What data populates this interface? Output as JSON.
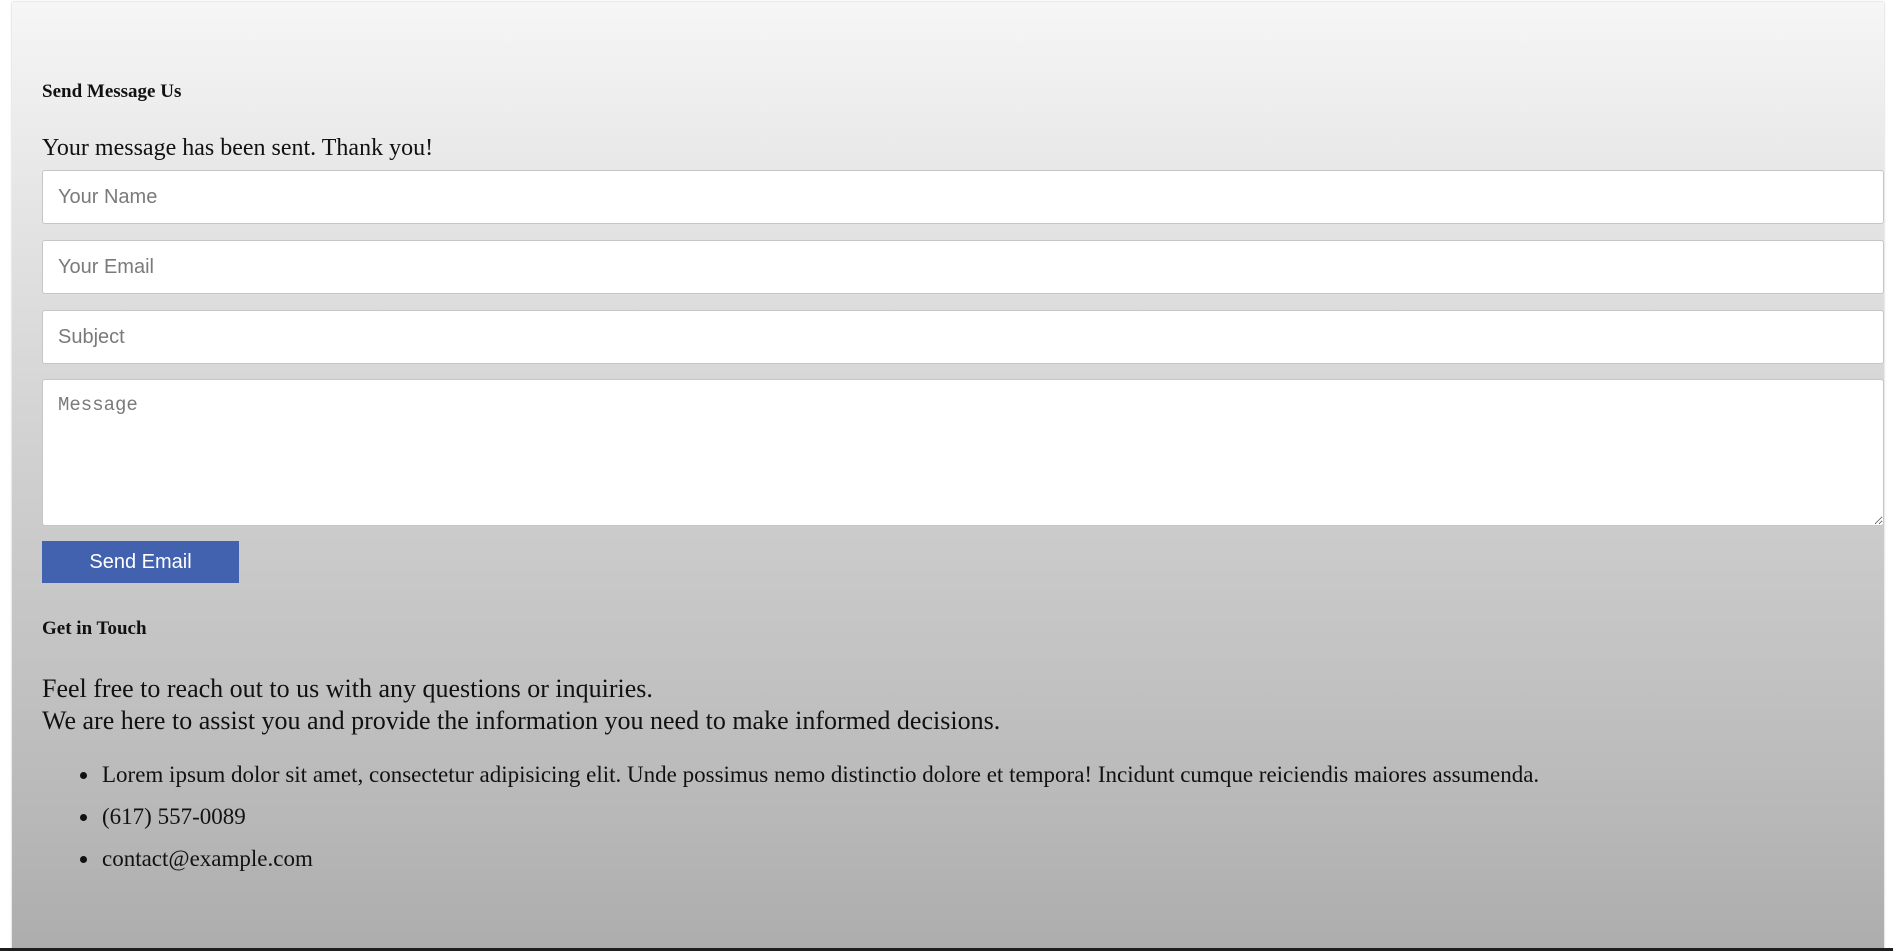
{
  "contact_form": {
    "title": "Send Message Us",
    "status_message": "Your message has been sent. Thank you!",
    "name_placeholder": "Your Name",
    "name_value": "",
    "email_placeholder": "Your Email",
    "email_value": "",
    "subject_placeholder": "Subject",
    "subject_value": "",
    "message_placeholder": "Message",
    "message_value": "",
    "submit_label": "Send Email"
  },
  "get_in_touch": {
    "title": "Get in Touch",
    "intro_line1": "Feel free to reach out to us with any questions or inquiries.",
    "intro_line2": "We are here to assist you and provide the information you need to make informed decisions.",
    "items": [
      "Lorem ipsum dolor sit amet, consectetur adipisicing elit. Unde possimus nemo distinctio dolore et tempora! Incidunt cumque reiciendis maiores assumenda.",
      "(617) 557-0089",
      "contact@example.com"
    ]
  },
  "colors": {
    "button_background": "#4262b0",
    "button_text": "#ffffff",
    "field_border": "#c6c6c6"
  }
}
